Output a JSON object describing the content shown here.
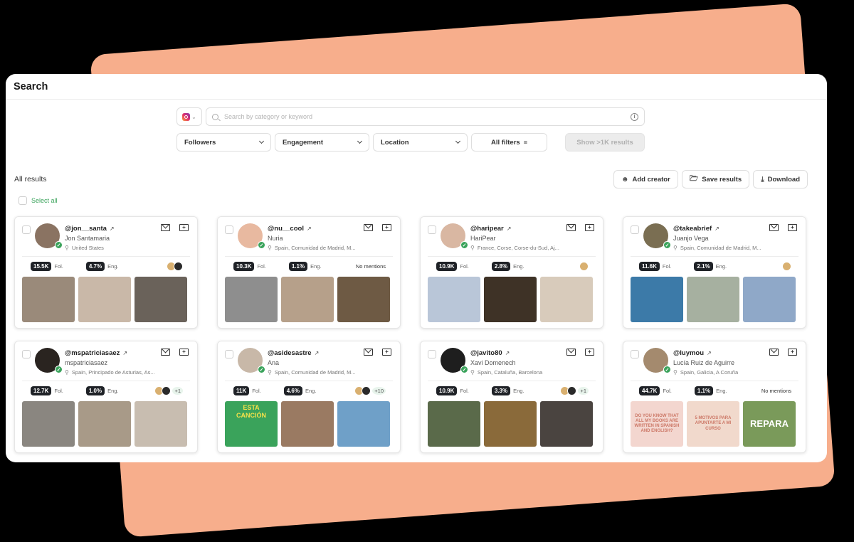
{
  "window": {
    "title": "Search"
  },
  "search": {
    "platform": "instagram",
    "placeholder": "Search by category or keyword",
    "value": ""
  },
  "filters": [
    {
      "label": "Followers",
      "type": "select"
    },
    {
      "label": "Engagement",
      "type": "select"
    },
    {
      "label": "Location",
      "type": "select"
    },
    {
      "label": "All filters",
      "type": "button"
    }
  ],
  "show_results_label": "Show >1K results",
  "results": {
    "label": "All results",
    "select_all_label": "Select all",
    "actions": [
      {
        "label": "Add creator",
        "icon": "add-user-icon"
      },
      {
        "label": "Save results",
        "icon": "folder-icon"
      },
      {
        "label": "Download",
        "icon": "download-icon"
      }
    ]
  },
  "labels": {
    "followers_suffix": "Fol.",
    "engagement_suffix": "Eng."
  },
  "creators": [
    {
      "handle": "@jon__santa",
      "name": "Jon Santamaria",
      "location": "United States",
      "followers": "15.5K",
      "engagement": "4.7%",
      "mentions": "",
      "mention_avatars": 2,
      "mention_more": "",
      "avatar_color": "#8a7362",
      "thumbs": [
        "#9a8a7a",
        "#c9b8a8",
        "#6a625a"
      ],
      "thumb_text": [
        "",
        "",
        ""
      ]
    },
    {
      "handle": "@nu__cool",
      "name": "Nuria",
      "location": "Spain, Comunidad de Madrid, M...",
      "followers": "10.3K",
      "engagement": "1.1%",
      "mentions": "No mentions",
      "mention_avatars": 0,
      "mention_more": "",
      "avatar_color": "#e8b9a0",
      "thumbs": [
        "#8e8e8e",
        "#b6a08a",
        "#6e5a44"
      ],
      "thumb_text": [
        "",
        "",
        ""
      ]
    },
    {
      "handle": "@haripear",
      "name": "HariPear",
      "location": "France, Corse, Corse-du-Sud, Aj...",
      "followers": "10.9K",
      "engagement": "2.8%",
      "mentions": "",
      "mention_avatars": 1,
      "mention_more": "",
      "avatar_color": "#d9b7a2",
      "thumbs": [
        "#b9c6d8",
        "#3e3226",
        "#d8cbbb"
      ],
      "thumb_text": [
        "",
        "",
        ""
      ]
    },
    {
      "handle": "@takeabrief",
      "name": "Juanjo Vega",
      "location": "Spain, Comunidad de Madrid, M...",
      "followers": "11.6K",
      "engagement": "2.1%",
      "mentions": "",
      "mention_avatars": 1,
      "mention_more": "",
      "avatar_color": "#7a6e52",
      "thumbs": [
        "#3c7aa8",
        "#a6b0a0",
        "#8fa8c8"
      ],
      "thumb_text": [
        "",
        "",
        ""
      ]
    },
    {
      "handle": "@mspatriciasaez",
      "name": "mspatriciasaez",
      "location": "Spain, Principado de Asturias, As...",
      "followers": "12.7K",
      "engagement": "1.0%",
      "mentions": "",
      "mention_avatars": 2,
      "mention_more": "+1",
      "avatar_color": "#2a2420",
      "thumbs": [
        "#8a8680",
        "#a89a88",
        "#c8bdb0"
      ],
      "thumb_text": [
        "",
        "",
        ""
      ]
    },
    {
      "handle": "@asidesastre",
      "name": "Ana",
      "location": "Spain, Comunidad de Madrid, M...",
      "followers": "11K",
      "engagement": "4.6%",
      "mentions": "",
      "mention_avatars": 2,
      "mention_more": "+10",
      "avatar_color": "#c8b8a8",
      "thumbs": [
        "#3aa35b",
        "#9a7a62",
        "#6fa0c8"
      ],
      "thumb_text": [
        "ESTA CANCIÓN",
        "",
        ""
      ]
    },
    {
      "handle": "@javito80",
      "name": "Xavi Domenech",
      "location": "Spain, Cataluña, Barcelona",
      "followers": "10.9K",
      "engagement": "3.3%",
      "mentions": "",
      "mention_avatars": 2,
      "mention_more": "+1",
      "avatar_color": "#1e1e1e",
      "thumbs": [
        "#5a6a4a",
        "#8a6a3a",
        "#4a4440"
      ],
      "thumb_text": [
        "",
        "",
        ""
      ]
    },
    {
      "handle": "@luymou",
      "name": "Lucía Ruiz de Aguirre",
      "location": "Spain, Galicia, A Coruña",
      "followers": "44.7K",
      "engagement": "1.1%",
      "mentions": "No mentions",
      "mention_avatars": 0,
      "mention_more": "",
      "avatar_color": "#a48a6e",
      "thumbs": [
        "#f3d6cf",
        "#f1d9cc",
        "#7a9a5a"
      ],
      "thumb_text": [
        "DO YOU KNOW THAT ALL MY BOOKS ARE WRITTEN IN SPANISH AND ENGLISH?",
        "5 MOTIVOS PARA APUNTARTE A MI CURSO",
        "REPARA"
      ]
    }
  ]
}
